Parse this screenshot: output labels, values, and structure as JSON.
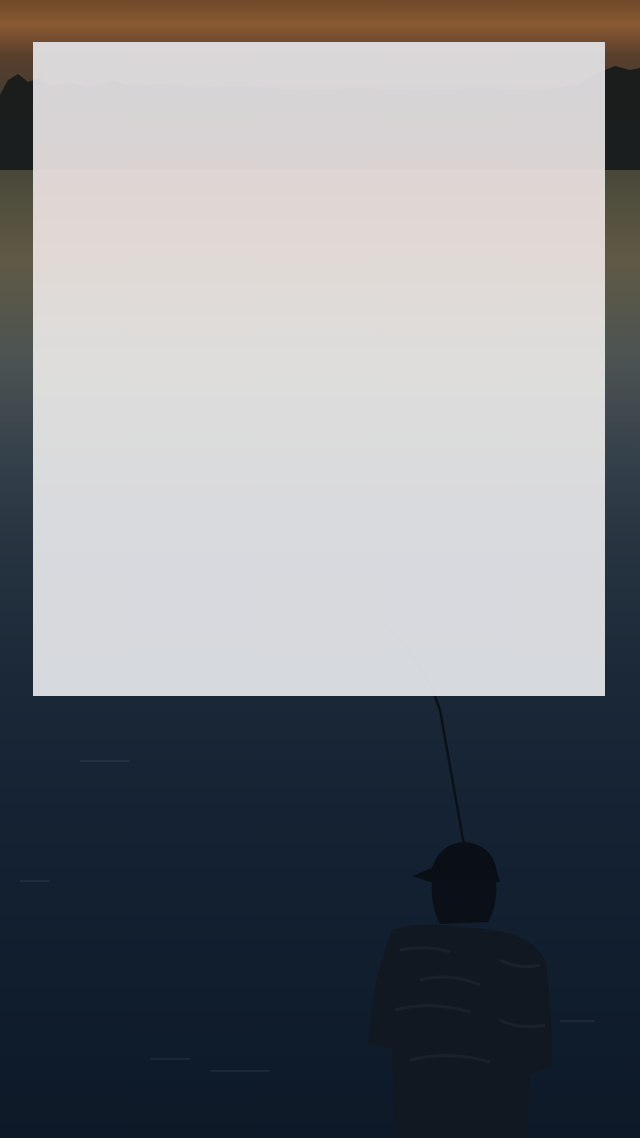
{
  "scene": {
    "description_colors": {
      "sky_top": "#8a5a33",
      "water_mid": "#34404a",
      "water_bottom": "#0d1927",
      "overlay": "#e4e4e8",
      "silhouette": "#0a0f16"
    }
  }
}
